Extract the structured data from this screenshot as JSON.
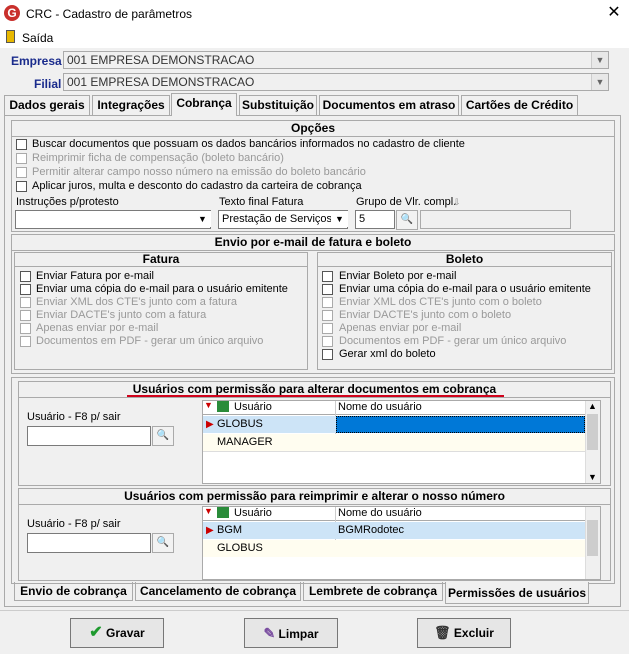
{
  "window": {
    "title": "CRC - Cadastro de parâmetros",
    "close": "✕"
  },
  "menu": {
    "saida": "Saída"
  },
  "empresa": {
    "label": "Empresa",
    "value": "001 EMPRESA DEMONSTRACAO"
  },
  "filial": {
    "label": "Filial",
    "value": "001 EMPRESA DEMONSTRACAO"
  },
  "tabs": [
    "Dados gerais",
    "Integrações",
    "Cobrança",
    "Substituição",
    "Documentos em atraso",
    "Cartões de Crédito"
  ],
  "opcoes": {
    "title": "Opções",
    "items": [
      "Buscar documentos que possuam os dados bancários informados no cadastro de cliente",
      "Reimprimir ficha de compensação (boleto bancário)",
      "Permitir alterar campo nosso número na emissão do boleto bancário",
      "Aplicar juros, multa e desconto do cadastro da carteira de cobrança"
    ],
    "instrucoes_label": "Instruções p/protesto",
    "texto_final_label": "Texto final Fatura",
    "texto_final_value": "Prestação de Serviços",
    "grupo_label": "Grupo de Vlr. compl.",
    "grupo_value": "5"
  },
  "envio": {
    "title": "Envio por e-mail de fatura e boleto",
    "fatura_title": "Fatura",
    "fatura_items": [
      "Enviar Fatura por e-mail",
      "Enviar uma cópia do e-mail para o usuário emitente",
      "Enviar XML dos CTE's  junto com a fatura",
      "Enviar DACTE's junto com a fatura",
      "Apenas enviar por e-mail",
      "Documentos em PDF - gerar um único arquivo"
    ],
    "boleto_title": "Boleto",
    "boleto_items": [
      "Enviar Boleto por e-mail",
      "Enviar uma cópia do e-mail para o usuário emitente",
      "Enviar XML dos CTE's  junto com o boleto",
      "Enviar DACTE's junto com o boleto",
      "Apenas enviar por e-mail",
      "Documentos em PDF - gerar um único arquivo",
      "Gerar xml do boleto"
    ]
  },
  "perm1": {
    "title": "Usuários com permissão para alterar documentos em cobrança",
    "usuario_label": "Usuário - F8 p/ sair",
    "col_usuario": "Usuário",
    "col_nome": "Nome do usuário",
    "rows": [
      {
        "usuario": "GLOBUS",
        "nome": ""
      },
      {
        "usuario": "MANAGER",
        "nome": ""
      }
    ]
  },
  "perm2": {
    "title": "Usuários com permissão para reimprimir e alterar o nosso número",
    "usuario_label": "Usuário - F8 p/ sair",
    "col_usuario": "Usuário",
    "col_nome": "Nome do usuário",
    "rows": [
      {
        "usuario": "BGM",
        "nome": "BGMRodotec"
      },
      {
        "usuario": "GLOBUS",
        "nome": ""
      }
    ]
  },
  "bottom_tabs": [
    "Envio de cobrança",
    "Cancelamento de cobrança",
    "Lembrete de cobrança",
    "Permissões de usuários"
  ],
  "buttons": {
    "gravar": "Gravar",
    "limpar": "Limpar",
    "excluir": "Excluir"
  },
  "colors": {
    "accent_blue": "#1a2b8c",
    "underline_red": "#d0021b",
    "selection": "#0078d7"
  }
}
